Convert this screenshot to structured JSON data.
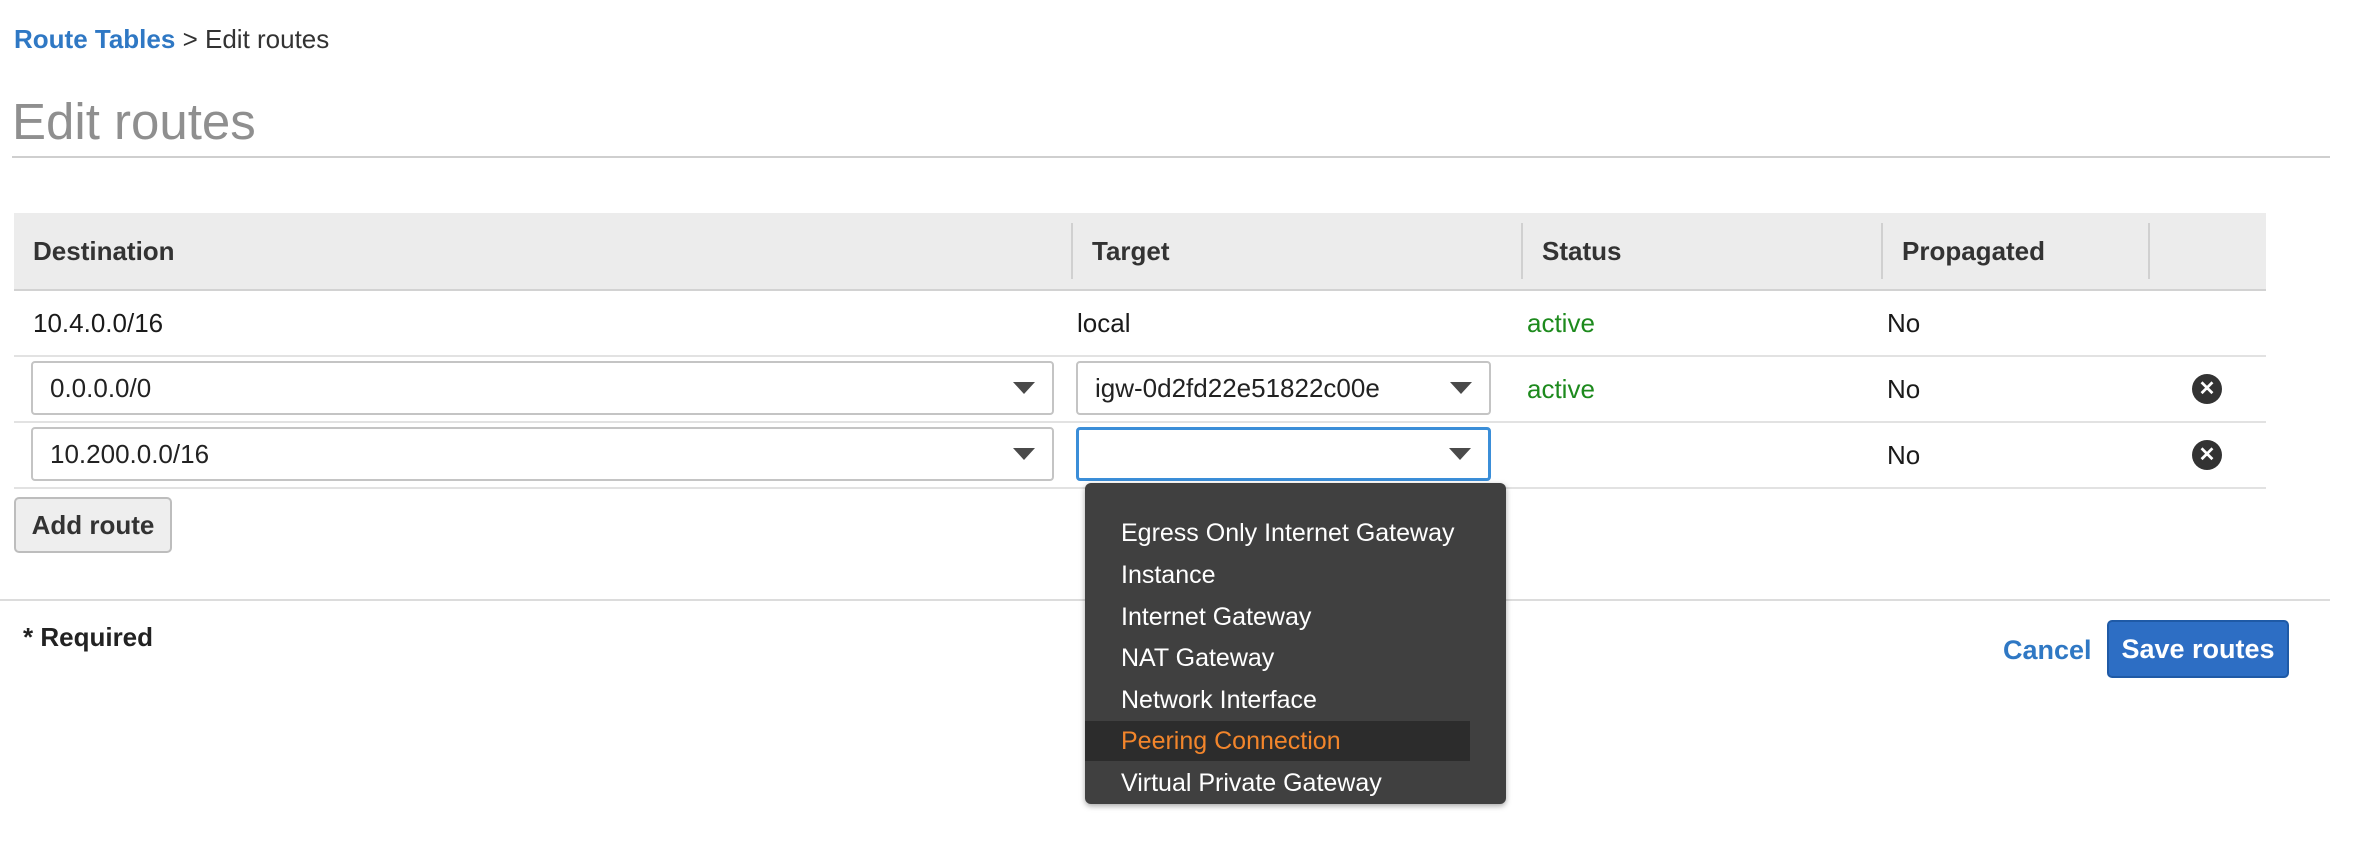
{
  "breadcrumb": {
    "parent": "Route Tables",
    "separator": ">",
    "current": "Edit routes"
  },
  "page": {
    "title": "Edit routes"
  },
  "table": {
    "headers": {
      "destination": "Destination",
      "target": "Target",
      "status": "Status",
      "propagated": "Propagated"
    },
    "rows": [
      {
        "destination": "10.4.0.0/16",
        "target": "local",
        "status": "active",
        "propagated": "No"
      },
      {
        "destination": "0.0.0.0/0",
        "target": "igw-0d2fd22e51822c00e",
        "status": "active",
        "propagated": "No"
      },
      {
        "destination": "10.200.0.0/16",
        "target": "",
        "status": "",
        "propagated": "No"
      }
    ]
  },
  "buttons": {
    "add_route": "Add route",
    "cancel": "Cancel",
    "save_routes": "Save routes",
    "remove": "✕"
  },
  "footer": {
    "required_note": "* Required"
  },
  "target_dropdown": {
    "options": [
      "Egress Only Internet Gateway",
      "Instance",
      "Internet Gateway",
      "NAT Gateway",
      "Network Interface",
      "Peering Connection",
      "Virtual Private Gateway"
    ],
    "highlighted_index": 5
  },
  "colors": {
    "link": "#2f78c4",
    "active_status": "#1d8a1d",
    "primary_button": "#2d6ec4",
    "dropdown_highlight": "#f2852b"
  },
  "icons": {
    "remove": "remove-circle-icon",
    "caret": "chevron-down-icon"
  }
}
